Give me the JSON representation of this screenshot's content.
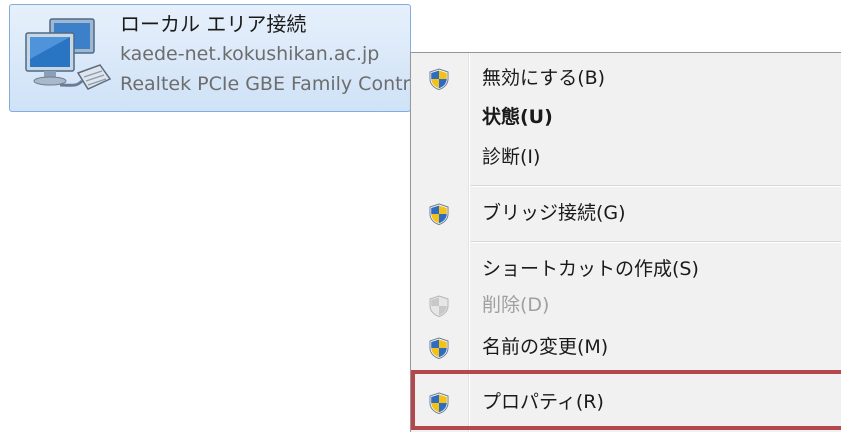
{
  "adapter": {
    "name": "ローカル エリア接続",
    "network": "kaede-net.kokushikan.ac.jp",
    "device": "Realtek PCIe GBE Family Controller",
    "icon": "network-adapter-icon"
  },
  "context_menu": {
    "items": [
      {
        "label": "無効にする(B)",
        "icon": "uac-shield-icon",
        "bold": false,
        "disabled": false
      },
      {
        "label": "状態(U)",
        "icon": "",
        "bold": true,
        "disabled": false
      },
      {
        "label": "診断(I)",
        "icon": "",
        "bold": false,
        "disabled": false
      },
      {
        "label": "ブリッジ接続(G)",
        "icon": "uac-shield-icon",
        "bold": false,
        "disabled": false
      },
      {
        "label": "ショートカットの作成(S)",
        "icon": "",
        "bold": false,
        "disabled": false
      },
      {
        "label": "削除(D)",
        "icon": "uac-shield-icon",
        "bold": false,
        "disabled": true
      },
      {
        "label": "名前の変更(M)",
        "icon": "uac-shield-icon",
        "bold": false,
        "disabled": false
      },
      {
        "label": "プロパティ(R)",
        "icon": "uac-shield-icon",
        "bold": false,
        "disabled": false
      }
    ]
  },
  "colors": {
    "tile_border": "#84acdd",
    "highlight_border": "#b3494d",
    "shield_blue": "#2f6bbf",
    "shield_yellow": "#f3c21a"
  }
}
